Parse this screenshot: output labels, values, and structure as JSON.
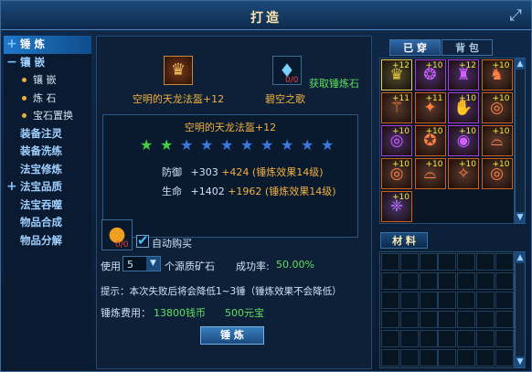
{
  "title": "打造",
  "close_icon": "close-arrow-icon",
  "sidebar": {
    "items": [
      {
        "label": "锤  炼",
        "marker": "+",
        "active": true,
        "sub": false
      },
      {
        "label": "镶  嵌",
        "marker": "−",
        "active": false,
        "sub": false
      },
      {
        "label": "镶 嵌",
        "marker": "",
        "active": false,
        "sub": true
      },
      {
        "label": "炼 石",
        "marker": "",
        "active": false,
        "sub": true
      },
      {
        "label": "宝石置换",
        "marker": "",
        "active": false,
        "sub": true
      },
      {
        "label": "装备注灵",
        "marker": "",
        "active": false,
        "sub": false
      },
      {
        "label": "装备洗练",
        "marker": "",
        "active": false,
        "sub": false
      },
      {
        "label": "法宝修炼",
        "marker": "",
        "active": false,
        "sub": false
      },
      {
        "label": "法宝品质",
        "marker": "+",
        "active": false,
        "sub": false
      },
      {
        "label": "法宝吞噬",
        "marker": "",
        "active": false,
        "sub": false
      },
      {
        "label": "物品合成",
        "marker": "",
        "active": false,
        "sub": false
      },
      {
        "label": "物品分解",
        "marker": "",
        "active": false,
        "sub": false
      }
    ]
  },
  "forge": {
    "item_name": "空明的天龙法盔+12",
    "stone_count": "0/0",
    "stone_name": "碧空之歌",
    "get_stone": "获取锤炼石",
    "info": {
      "name": "空明的天龙法盔+12",
      "stars_filled": 2,
      "stars_total": 10,
      "defense_label": "防御",
      "defense_base": "+303",
      "defense_bonus": "+424 (锤炼效果14级)",
      "life_label": "生命",
      "life_base": "+1402",
      "life_bonus": "+1962 (锤炼效果14级)"
    },
    "ore_count": "0/0",
    "auto_buy_label": "自动购买",
    "auto_buy_checked": true,
    "use_label": "使用",
    "use_value": "5",
    "use_suffix": "个源质矿石",
    "success_label": "成功率:",
    "success_value": "50.00%",
    "hint": "提示：本次失败后将会降低1~3锤（锤炼效果不会降低）",
    "cost_label": "锤炼费用：",
    "cost_coins": "13800钱币",
    "cost_gold": "500元宝",
    "action_button": "锤  炼"
  },
  "bag": {
    "tabs": [
      "已  穿",
      "背  包"
    ],
    "active_tab": 0,
    "items": [
      {
        "badge": "+12",
        "icon": "helmet-icon",
        "color": "#e0c040",
        "border": "#e8d060"
      },
      {
        "badge": "+10",
        "icon": "necklace-icon",
        "color": "#d060ff",
        "border": "#a040e0"
      },
      {
        "badge": "+12",
        "icon": "armor-icon",
        "color": "#d060ff",
        "border": "#a040e0"
      },
      {
        "badge": "+10",
        "icon": "boots-icon",
        "color": "#ff8040",
        "border": "#d06020"
      },
      {
        "badge": "+11",
        "icon": "staff-icon",
        "color": "#ff8040",
        "border": "#d06020"
      },
      {
        "badge": "+11",
        "icon": "belt-icon",
        "color": "#ff8040",
        "border": "#d06020"
      },
      {
        "badge": "+10",
        "icon": "gloves-icon",
        "color": "#d060ff",
        "border": "#a040e0"
      },
      {
        "badge": "+10",
        "icon": "ring-icon",
        "color": "#ff8040",
        "border": "#d06020"
      },
      {
        "badge": "+10",
        "icon": "ring-icon",
        "color": "#d060ff",
        "border": "#a040e0"
      },
      {
        "badge": "+10",
        "icon": "charm-icon",
        "color": "#ff8040",
        "border": "#d06020"
      },
      {
        "badge": "+10",
        "icon": "orb-icon",
        "color": "#d060ff",
        "border": "#a040e0"
      },
      {
        "badge": "+10",
        "icon": "bracer-icon",
        "color": "#ff8040",
        "border": "#d06020"
      },
      {
        "badge": "+10",
        "icon": "ring-icon",
        "color": "#ff8040",
        "border": "#d06020"
      },
      {
        "badge": "+10",
        "icon": "bracer-icon",
        "color": "#ff8040",
        "border": "#d06020"
      },
      {
        "badge": "+10",
        "icon": "amulet-icon",
        "color": "#ff8040",
        "border": "#d06020"
      },
      {
        "badge": "+10",
        "icon": "ring-icon",
        "color": "#ff8040",
        "border": "#d06020"
      },
      {
        "badge": "+10",
        "icon": "wing-icon",
        "color": "#c070ff",
        "border": "#d06020"
      }
    ],
    "materials_tab": "材  料"
  }
}
